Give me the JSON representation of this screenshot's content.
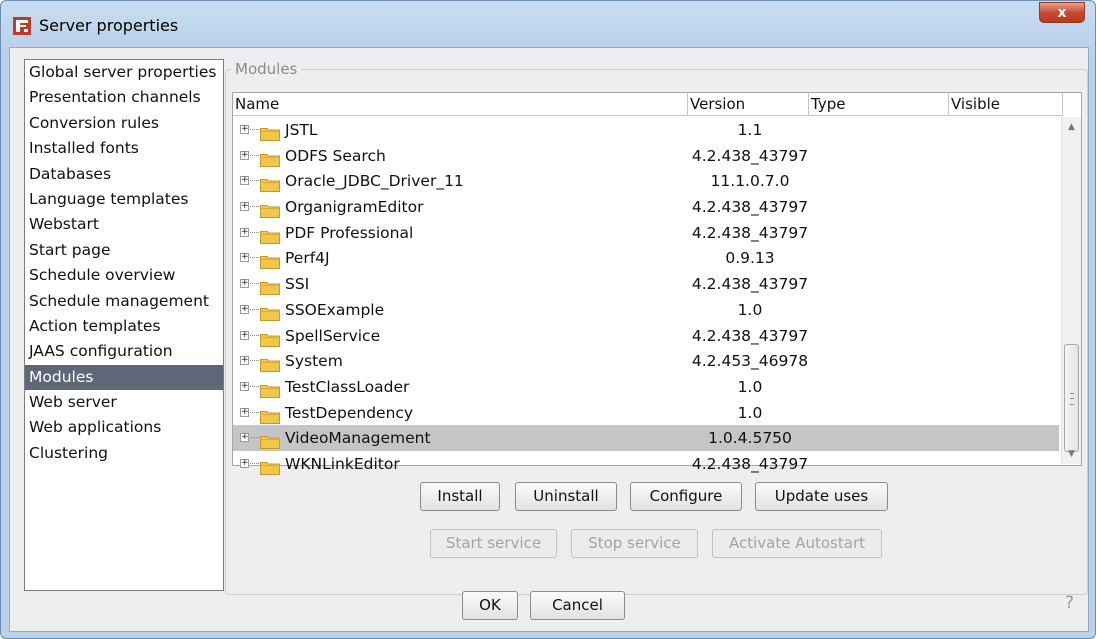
{
  "window": {
    "title": "Server properties",
    "close_label": "x"
  },
  "sidebar": {
    "items": [
      {
        "label": "Global server properties"
      },
      {
        "label": "Presentation channels"
      },
      {
        "label": "Conversion rules"
      },
      {
        "label": "Installed fonts"
      },
      {
        "label": "Databases"
      },
      {
        "label": "Language templates"
      },
      {
        "label": "Webstart"
      },
      {
        "label": "Start page"
      },
      {
        "label": "Schedule overview"
      },
      {
        "label": "Schedule management"
      },
      {
        "label": "Action templates"
      },
      {
        "label": "JAAS configuration"
      },
      {
        "label": "Modules",
        "selected": true
      },
      {
        "label": "Web server"
      },
      {
        "label": "Web applications"
      },
      {
        "label": "Clustering"
      }
    ]
  },
  "modules": {
    "group_title": "Modules",
    "columns": {
      "name": "Name",
      "version": "Version",
      "type": "Type",
      "visible": "Visible"
    },
    "rows": [
      {
        "name": "JSTL",
        "version": "1.1"
      },
      {
        "name": "ODFS Search",
        "version": "4.2.438_43797"
      },
      {
        "name": "Oracle_JDBC_Driver_11",
        "version": "11.1.0.7.0"
      },
      {
        "name": "OrganigramEditor",
        "version": "4.2.438_43797"
      },
      {
        "name": "PDF Professional",
        "version": "4.2.438_43797"
      },
      {
        "name": "Perf4J",
        "version": "0.9.13"
      },
      {
        "name": "SSI",
        "version": "4.2.438_43797"
      },
      {
        "name": "SSOExample",
        "version": "1.0"
      },
      {
        "name": "SpellService",
        "version": "4.2.438_43797"
      },
      {
        "name": "System",
        "version": "4.2.453_46978"
      },
      {
        "name": "TestClassLoader",
        "version": "1.0"
      },
      {
        "name": "TestDependency",
        "version": "1.0"
      },
      {
        "name": "VideoManagement",
        "version": "1.0.4.5750",
        "selected": true
      },
      {
        "name": "WKNLinkEditor",
        "version": "4.2.438_43797"
      }
    ],
    "buttons": {
      "install": "Install",
      "uninstall": "Uninstall",
      "configure": "Configure",
      "update_uses": "Update uses",
      "start_service": "Start service",
      "stop_service": "Stop service",
      "activate_autostart": "Activate Autostart"
    }
  },
  "footer": {
    "ok": "OK",
    "cancel": "Cancel",
    "help": "?"
  },
  "colors": {
    "selection_sidebar": "#5f6677",
    "selection_row": "#c5c5c7",
    "folder": "#f1c64a",
    "close_button": "#c74a32"
  }
}
